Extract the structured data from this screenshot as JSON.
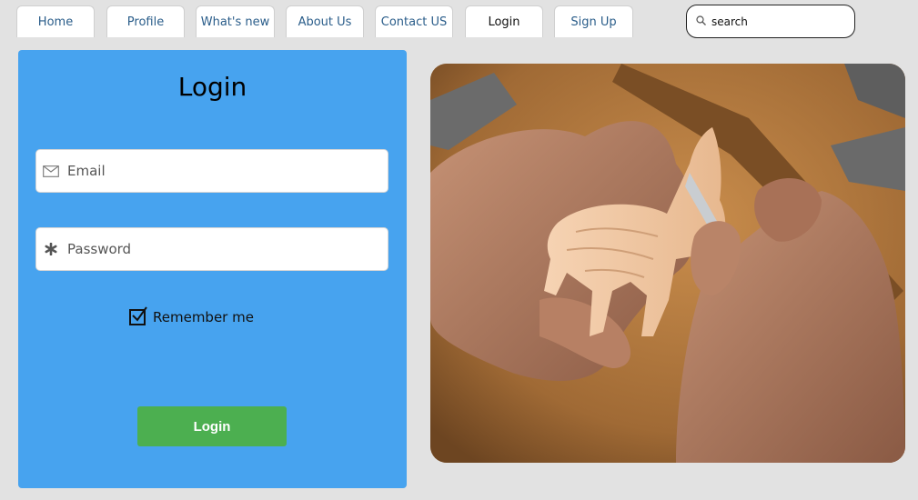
{
  "nav": {
    "tabs": [
      {
        "label": "Home"
      },
      {
        "label": "Profile"
      },
      {
        "label": "What's new"
      },
      {
        "label": "About Us"
      },
      {
        "label": "Contact US"
      },
      {
        "label": "Login"
      },
      {
        "label": "Sign Up"
      }
    ],
    "active_tab": "Login"
  },
  "search": {
    "placeholder": "search",
    "icon": "search-icon"
  },
  "login_form": {
    "title": "Login",
    "email": {
      "placeholder": "Email",
      "value": "",
      "icon": "envelope-icon"
    },
    "password": {
      "placeholder": "Password",
      "value": "",
      "icon": "asterisk-icon"
    },
    "remember": {
      "label": "Remember me",
      "checked": true
    },
    "submit_label": "Login"
  },
  "colors": {
    "page_bg": "#e2e2e2",
    "panel_bg": "#47a3ef",
    "button_bg": "#4caf50",
    "tab_text": "#2a5d8a"
  },
  "hero_image": {
    "subject": "hands-carving-wooden-goat-photo"
  }
}
